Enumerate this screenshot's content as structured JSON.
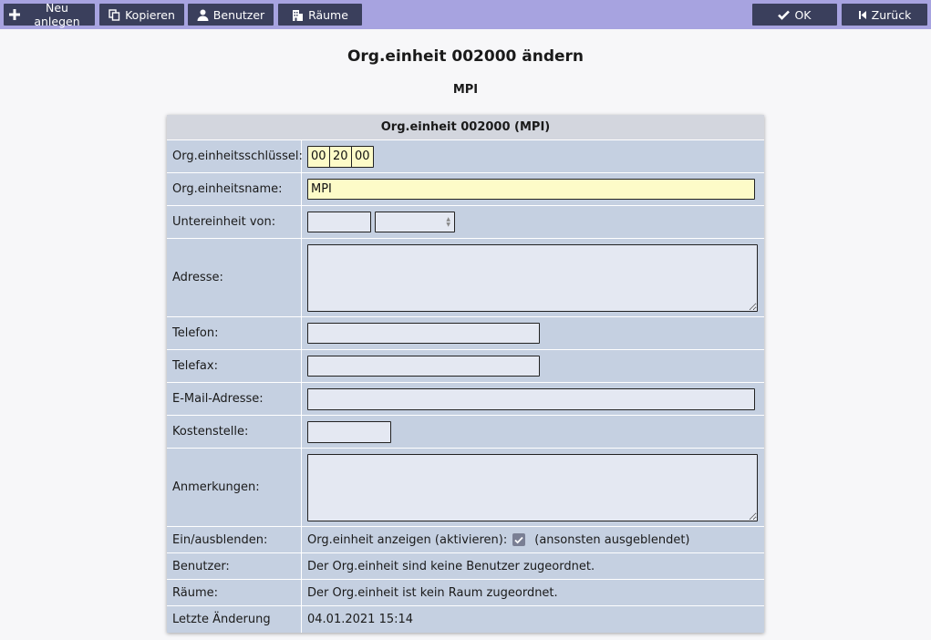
{
  "toolbar": {
    "new_label": "Neu anlegen",
    "copy_label": "Kopieren",
    "users_label": "Benutzer",
    "rooms_label": "Räume",
    "ok_label": "OK",
    "back_label": "Zurück"
  },
  "page": {
    "title": "Org.einheit 002000 ändern",
    "subtitle": "MPI"
  },
  "panel": {
    "header": "Org.einheit 002000 (MPI)"
  },
  "form": {
    "key": {
      "label": "Org.einheitsschlüssel:",
      "part1": "00",
      "part2": "20",
      "part3": "00"
    },
    "name": {
      "label": "Org.einheitsname:",
      "value": "MPI"
    },
    "parent": {
      "label": "Untereinheit von:",
      "value": ""
    },
    "address": {
      "label": "Adresse:",
      "value": ""
    },
    "phone": {
      "label": "Telefon:",
      "value": ""
    },
    "fax": {
      "label": "Telefax:",
      "value": ""
    },
    "email": {
      "label": "E-Mail-Adresse:",
      "value": ""
    },
    "cost_center": {
      "label": "Kostenstelle:",
      "value": ""
    },
    "notes": {
      "label": "Anmerkungen:",
      "value": ""
    },
    "visibility": {
      "label": "Ein/ausblenden:",
      "checkbox_label": "Org.einheit anzeigen (aktivieren):",
      "checked": true,
      "hint": "(ansonsten ausgeblendet)"
    },
    "users": {
      "label": "Benutzer:",
      "text": "Der Org.einheit sind keine Benutzer zugeordnet."
    },
    "rooms": {
      "label": "Räume:",
      "text": "Der Org.einheit ist kein Raum zugeordnet."
    },
    "last_change": {
      "label": "Letzte Änderung",
      "text": "04.01.2021 15:14"
    }
  },
  "colors": {
    "toolbar_bg": "#a7a3e0",
    "button_bg": "#3a3f5c",
    "panel_bg": "#c5d0e1",
    "required_field_bg": "#fdfbc8"
  },
  "icons": {
    "new": "plus-icon",
    "copy": "copy-icon",
    "users": "user-icon",
    "rooms": "building-icon",
    "ok": "check-icon",
    "back": "skip-back-icon"
  }
}
